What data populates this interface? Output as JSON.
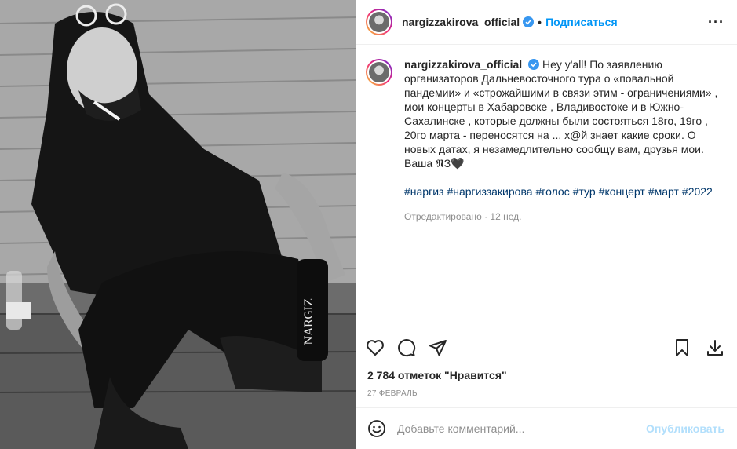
{
  "post": {
    "username": "nargizzakirova_official",
    "follow_label": "Подписаться",
    "dot": "•",
    "more": "···"
  },
  "caption": {
    "username": "nargizzakirova_official",
    "text": "Hey y'all! По заявлению организаторов Дальневосточного тура о «повальной пандемии» и «строжайшими в связи этим - ограничениями» , мои концерты в Хабаровске , Владивостоке и в Южно- Сахалинске , которые должны были состояться 18го, 19го , 20го марта - переносятся на ... х@й знает какие сроки. О новых датах, я незамедлительно сообщу вам, друзья мои.\nВаша 𝕹З🖤",
    "hashtags": [
      "#наргиз",
      "#наргиззакирова",
      "#голос",
      "#тур",
      "#концерт",
      "#март",
      "#2022"
    ],
    "meta": "Отредактировано · 12 нед."
  },
  "stats": {
    "likes": "2 784 отметок \"Нравится\"",
    "date": "27 ФЕВРАЛЬ"
  },
  "comment": {
    "placeholder": "Добавьте комментарий...",
    "publish_label": "Опубликовать"
  },
  "photo": {
    "bottle_text": "NARGIZ"
  },
  "colors": {
    "accent": "#0095f6",
    "hashtag": "#00376b",
    "muted": "#8e8e8e",
    "publish_disabled": "#b2dffc"
  }
}
